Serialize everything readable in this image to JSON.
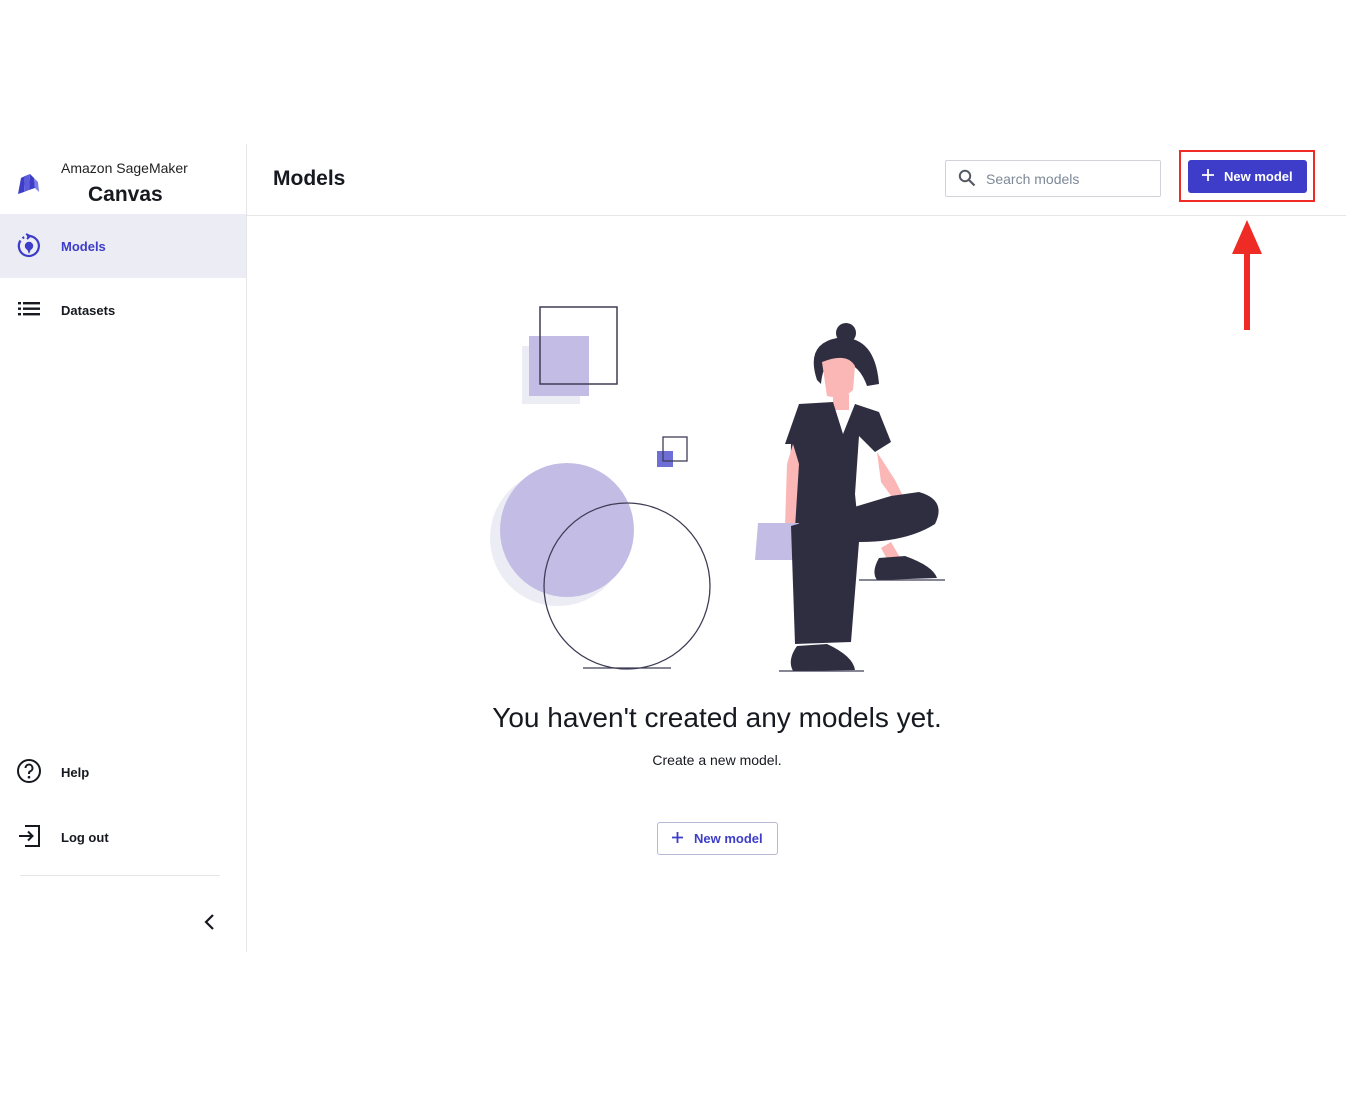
{
  "brand": {
    "subtitle": "Amazon SageMaker",
    "name": "Canvas",
    "logo_icon": "sagemaker-canvas-logo"
  },
  "sidebar": {
    "items": [
      {
        "label": "Models",
        "icon": "models-icon",
        "active": true
      },
      {
        "label": "Datasets",
        "icon": "list-icon",
        "active": false
      }
    ],
    "footer_items": [
      {
        "label": "Help",
        "icon": "help-circle-icon"
      },
      {
        "label": "Log out",
        "icon": "logout-icon"
      }
    ],
    "collapse_icon": "chevron-left-icon"
  },
  "header": {
    "title": "Models",
    "search_placeholder": "Search models",
    "new_model_label": "New model"
  },
  "empty_state": {
    "title": "You haven't created any models yet.",
    "subtitle": "Create a new model.",
    "button_label": "New model"
  },
  "colors": {
    "accent": "#3d3dc9",
    "active_nav_bg": "#ececf4",
    "highlight": "#ee2b24",
    "illustration_lavender": "#c3bde6"
  }
}
